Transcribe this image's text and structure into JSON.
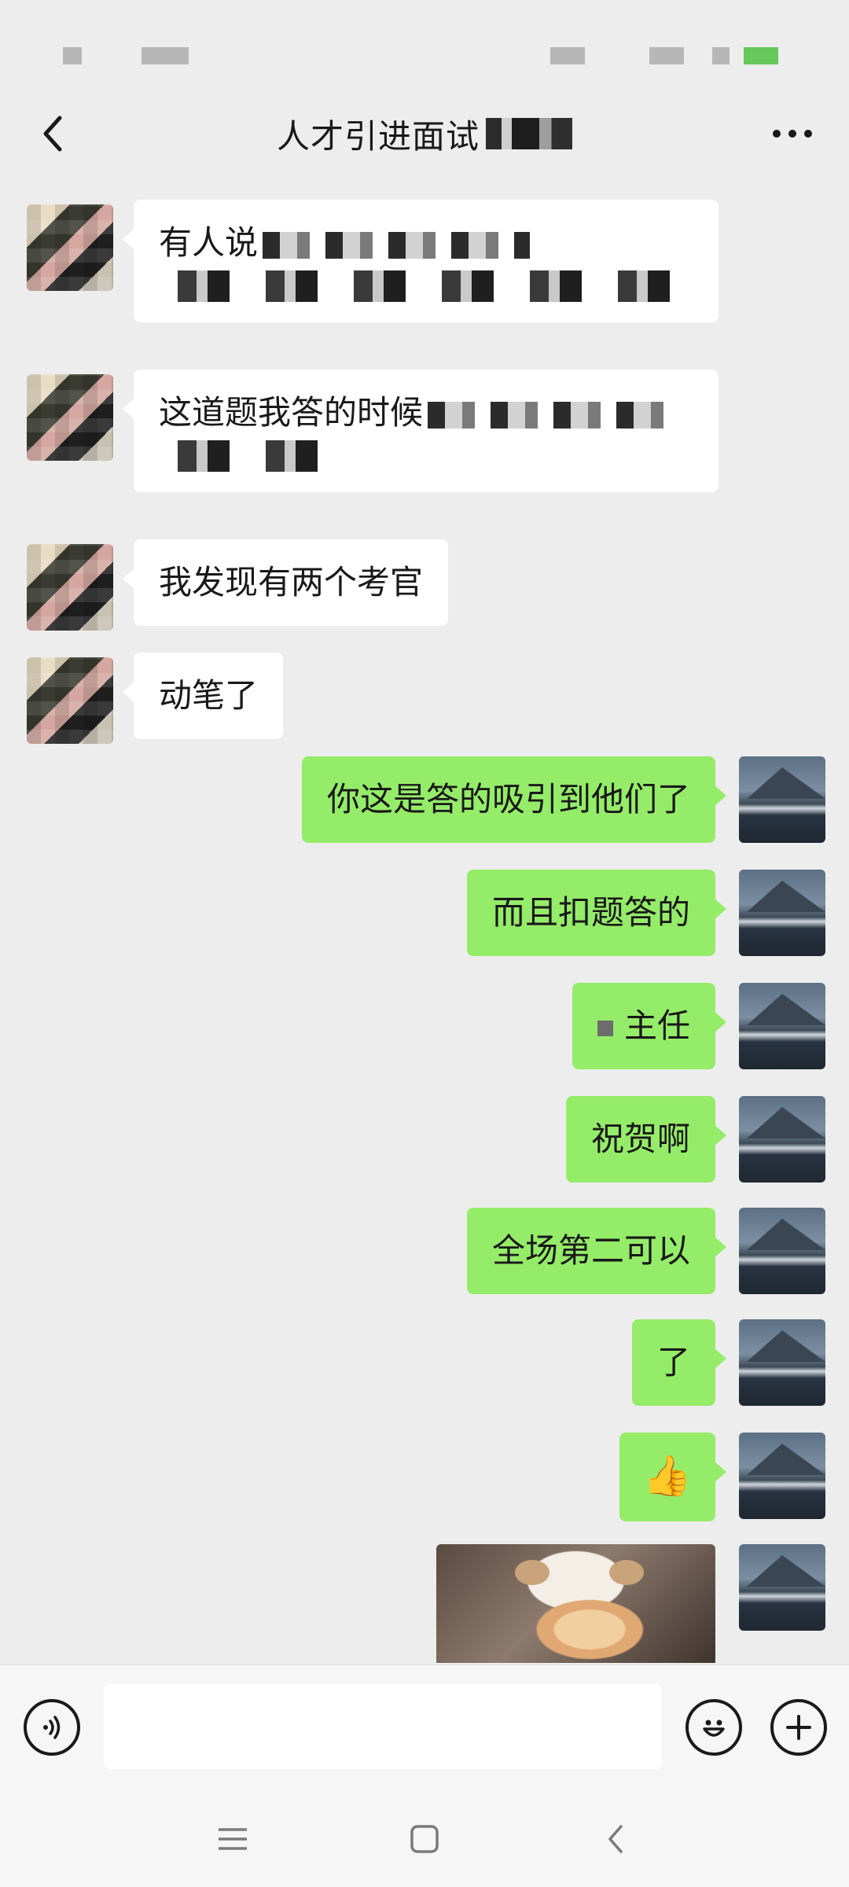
{
  "header": {
    "title": "人才引进面试"
  },
  "messages": [
    {
      "side": "left",
      "text": "有人说"
    },
    {
      "side": "left",
      "text": "这道题我答的时候"
    },
    {
      "side": "left",
      "text": "我发现有两个考官"
    },
    {
      "side": "left",
      "text": "动笔了"
    },
    {
      "side": "right",
      "text": "你这是答的吸引到他们了"
    },
    {
      "side": "right",
      "text": "而且扣题答的"
    },
    {
      "side": "right",
      "text": "主任"
    },
    {
      "side": "right",
      "text": "祝贺啊"
    },
    {
      "side": "right",
      "text": "全场第二可以"
    },
    {
      "side": "right",
      "text": "了"
    },
    {
      "side": "right",
      "text": "👍"
    }
  ],
  "icons": {
    "back": "back-chevron-icon",
    "more": "more-dots-icon",
    "voice": "voice-icon",
    "emoji": "emoji-icon",
    "plus": "plus-icon",
    "nav_menu": "menu-icon",
    "nav_home": "home-icon",
    "nav_back": "back-icon"
  },
  "colors": {
    "background": "#ededed",
    "bubble_incoming": "#ffffff",
    "bubble_outgoing": "#95ec69"
  }
}
